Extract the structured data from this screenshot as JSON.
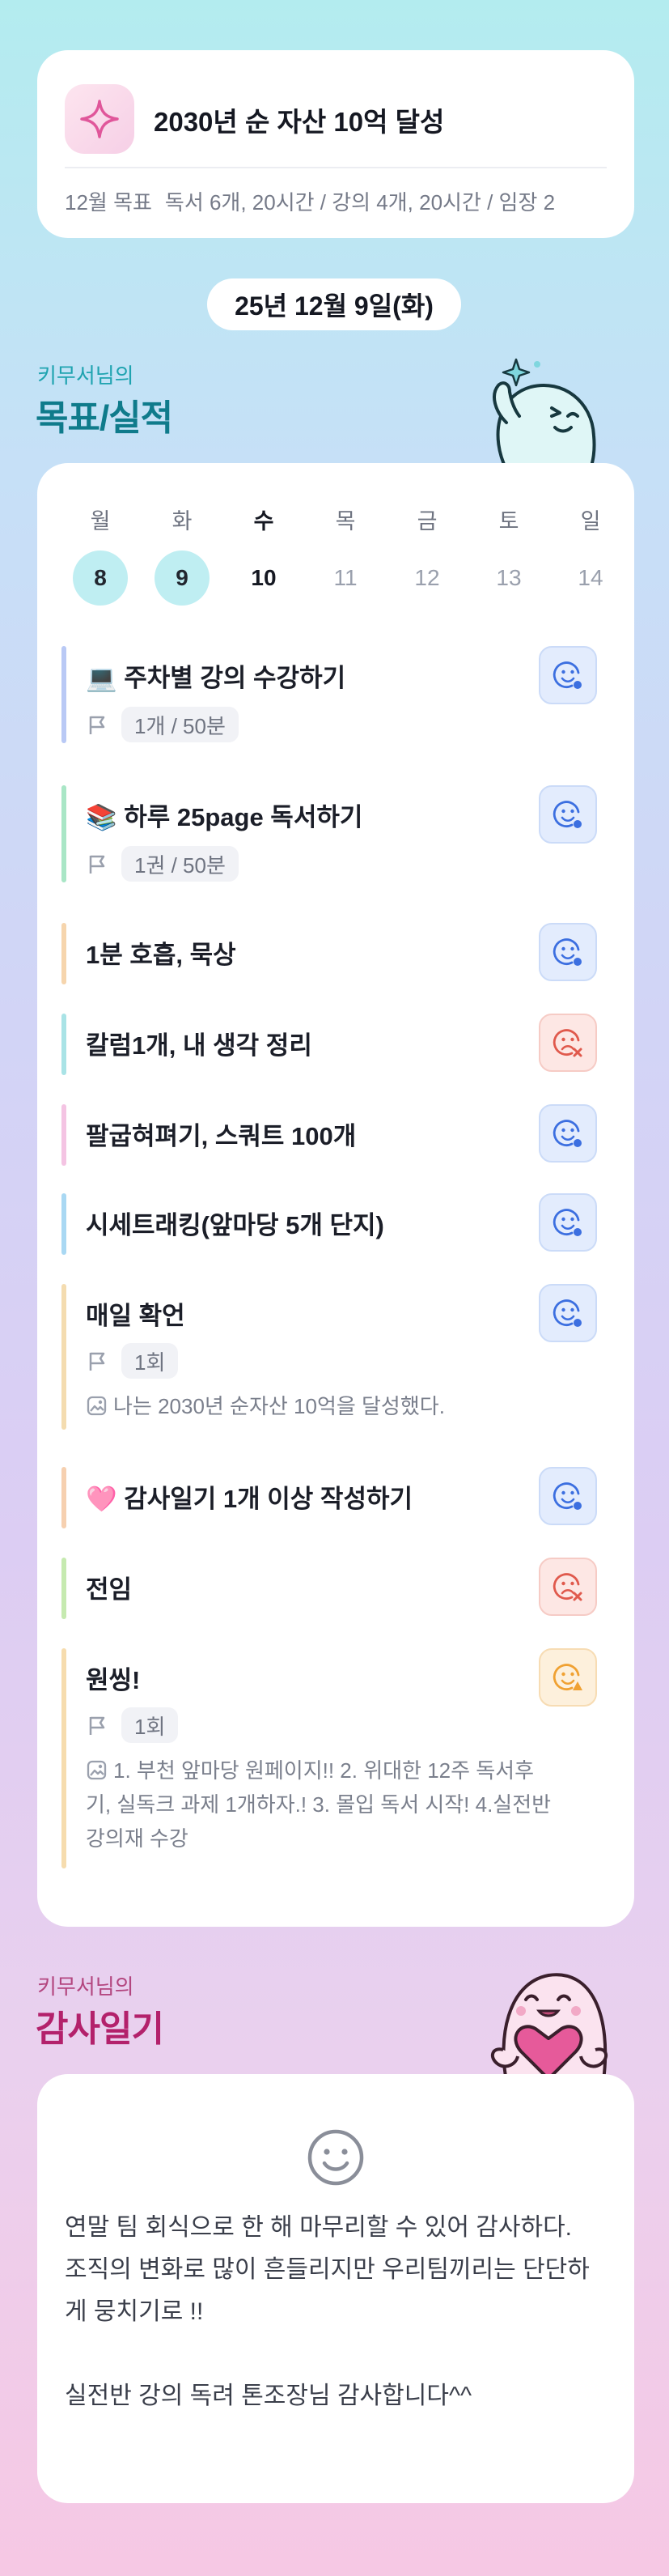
{
  "goal": {
    "title": "2030년 순 자산 10억 달성",
    "month_label": "12월 목표",
    "month_goals": "독서 6개, 20시간 / 강의 4개, 20시간 / 임장 2"
  },
  "date": "25년 12월 9일(화)",
  "section1": {
    "owner": "키무서님의",
    "title": "목표/실적"
  },
  "week": [
    {
      "name": "월",
      "num": "8",
      "state": "done"
    },
    {
      "name": "화",
      "num": "9",
      "state": "done"
    },
    {
      "name": "수",
      "num": "10",
      "state": "today"
    },
    {
      "name": "목",
      "num": "11",
      "state": "future"
    },
    {
      "name": "금",
      "num": "12",
      "state": "future"
    },
    {
      "name": "토",
      "num": "13",
      "state": "future"
    },
    {
      "name": "일",
      "num": "14",
      "state": "future"
    }
  ],
  "tasks": [
    {
      "title": "💻 주차별 강의 수강하기",
      "meta": "1개 / 50분",
      "status": "ok",
      "color": "#b9c9f5"
    },
    {
      "title": "📚 하루 25page 독서하기",
      "meta": "1권 / 50분",
      "status": "ok",
      "color": "#a9e6c6"
    },
    {
      "title": "1분 호흡, 묵상",
      "status": "ok",
      "color": "#f6d5ad"
    },
    {
      "title": "칼럼1개, 내 생각 정리",
      "status": "x",
      "color": "#a9e3e6"
    },
    {
      "title": "팔굽혀펴기, 스쿼트 100개",
      "status": "ok",
      "color": "#f4c4e3"
    },
    {
      "title": "시세트래킹(앞마당 5개 단지)",
      "status": "ok",
      "color": "#a9d8f3"
    },
    {
      "title": "매일 확언",
      "meta": "1회",
      "memo": "나는 2030년 순자산 10억을 달성했다.",
      "status": "ok",
      "color": "#f4dcb0"
    },
    {
      "title": "🩷 감사일기 1개 이상 작성하기",
      "status": "ok",
      "color": "#f6d0b0"
    },
    {
      "title": "전임",
      "status": "x",
      "color": "#c6eab0"
    },
    {
      "title": "원씽!",
      "meta": "1회",
      "memo": "1. 부천 앞마당 원페이지!! 2. 위대한 12주 독서후기, 실독크 과제 1개하자.! 3. 몰입 독서 시작! 4.실전반 강의재 수강",
      "status": "warn",
      "color": "#f6dcae"
    }
  ],
  "section2": {
    "owner": "키무서님의",
    "title": "감사일기"
  },
  "diary": {
    "text": "연말 팀 회식으로 한 해 마무리할 수 있어 감사하다.\n조직의 변화로 많이 흔들리지만 우리팀끼리는 단단하게 뭉치기로 !!\n\n실전반 강의 독려 톤조장님 감사합니다^^"
  },
  "icons": {
    "goal": "sparkle-icon",
    "meta": "flag-icon",
    "memo": "memo-image-icon",
    "status_ok": "smile-check-icon",
    "status_x": "sad-x-icon",
    "status_warn": "face-warning-icon",
    "diary": "smile-face-icon"
  },
  "colors": {
    "ok": "#3c6fe0",
    "x": "#e0594c",
    "warn": "#f0a132",
    "teal": "#0f7b8b",
    "pink": "#b3216b"
  }
}
